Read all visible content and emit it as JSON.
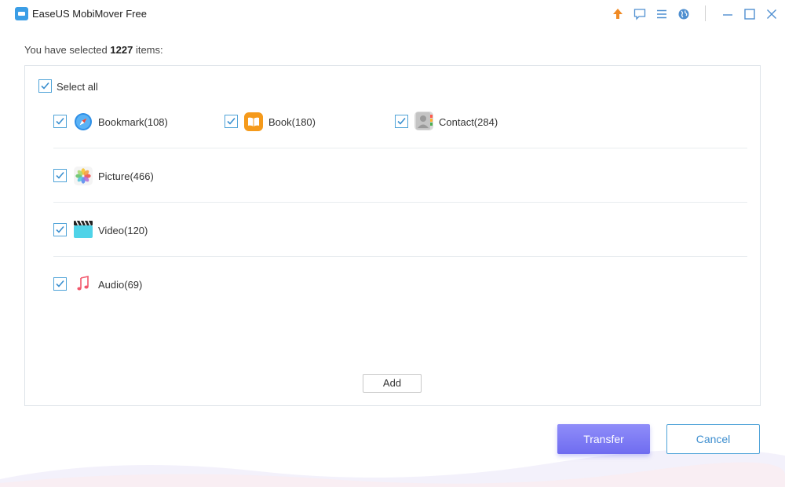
{
  "window": {
    "title": "EaseUS MobiMover Free",
    "icons": [
      "upgrade-icon",
      "feedback-icon",
      "menu-icon",
      "language-icon",
      "minimize-icon",
      "maximize-icon",
      "close-icon"
    ]
  },
  "summary": {
    "prefix": "You have selected",
    "count": "1227",
    "suffix": "items:"
  },
  "select_all": {
    "label": "Select all",
    "checked": true
  },
  "categories": [
    {
      "label": "Bookmark(108)",
      "icon": "safari-icon",
      "checked": true
    },
    {
      "label": "Book(180)",
      "icon": "books-icon",
      "checked": true
    },
    {
      "label": "Contact(284)",
      "icon": "contacts-icon",
      "checked": true
    },
    {
      "label": "Picture(466)",
      "icon": "photos-icon",
      "checked": true
    },
    {
      "label": "Video(120)",
      "icon": "video-icon",
      "checked": true
    },
    {
      "label": "Audio(69)",
      "icon": "music-icon",
      "checked": true
    }
  ],
  "buttons": {
    "add": "Add",
    "transfer": "Transfer",
    "cancel": "Cancel"
  },
  "colors": {
    "accent": "#4fa3d8",
    "transfer": "#7b79f5",
    "upgrade": "#f08a24"
  }
}
